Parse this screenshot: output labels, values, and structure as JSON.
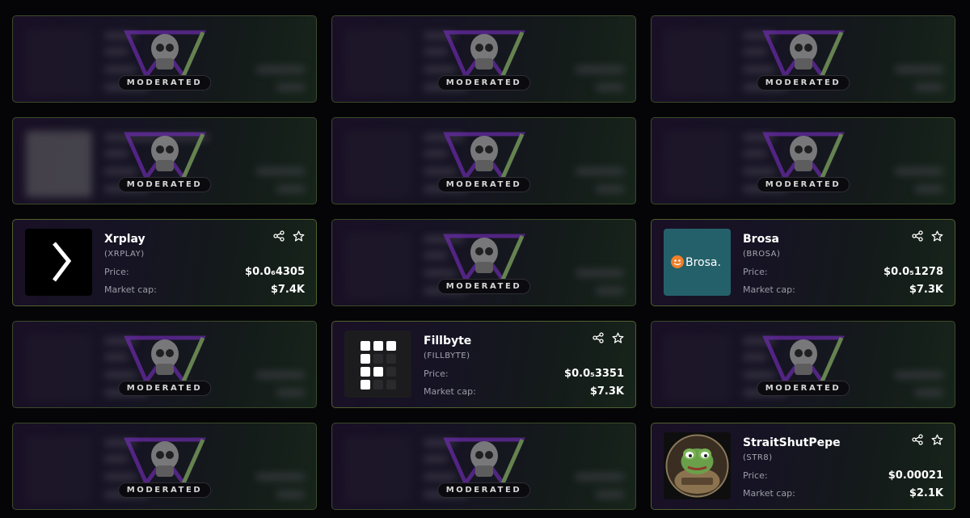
{
  "moderated_label": "MODERATED",
  "labels": {
    "price": "Price:",
    "market_cap": "Market cap:"
  },
  "tokens": {
    "xrplay": {
      "name": "Xrplay",
      "ticker": "(XRPLAY)",
      "price": "$0.0₆4305",
      "market_cap": "$7.4K"
    },
    "brosa": {
      "name": "Brosa",
      "ticker": "(BROSA)",
      "price": "$0.0₅1278",
      "market_cap": "$7.3K",
      "logo_text": "Brosa."
    },
    "fillbyte": {
      "name": "Fillbyte",
      "ticker": "(FILLBYTE)",
      "price": "$0.0₅3351",
      "market_cap": "$7.3K"
    },
    "straitshutpepe": {
      "name": "StraitShutPepe",
      "ticker": "(STR8)",
      "price": "$0.00021",
      "market_cap": "$2.1K"
    }
  },
  "colors": {
    "accent_green": "#7ab24a",
    "accent_purple": "#7a2fc4",
    "brosa_teal": "#24606a",
    "brosa_orange": "#f07f2a"
  }
}
